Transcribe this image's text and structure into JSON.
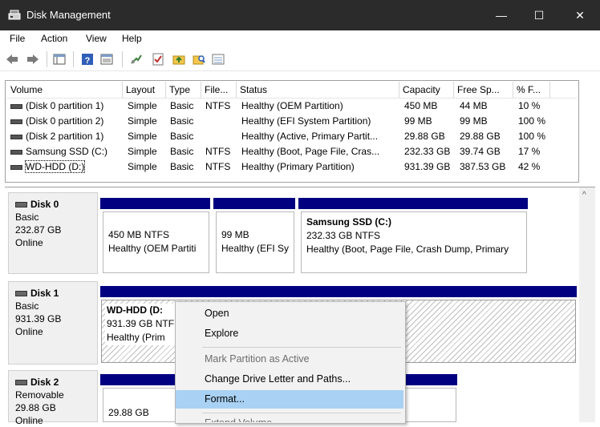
{
  "window": {
    "title": "Disk Management",
    "minimize": "—",
    "maximize": "☐",
    "close": "✕"
  },
  "menu": [
    "File",
    "Action",
    "View",
    "Help"
  ],
  "volume_list": {
    "columns": [
      "Volume",
      "Layout",
      "Type",
      "File...",
      "Status",
      "Capacity",
      "Free Sp...",
      "% F..."
    ],
    "rows": [
      [
        "(Disk 0 partition 1)",
        "Simple",
        "Basic",
        "NTFS",
        "Healthy (OEM Partition)",
        "450 MB",
        "44 MB",
        "10 %"
      ],
      [
        "(Disk 0 partition 2)",
        "Simple",
        "Basic",
        "",
        "Healthy (EFI System Partition)",
        "99 MB",
        "99 MB",
        "100 %"
      ],
      [
        "(Disk 2 partition 1)",
        "Simple",
        "Basic",
        "",
        "Healthy (Active, Primary Partit...",
        "29.88 GB",
        "29.88 GB",
        "100 %"
      ],
      [
        "Samsung SSD (C:)",
        "Simple",
        "Basic",
        "NTFS",
        "Healthy (Boot, Page File, Cras...",
        "232.33 GB",
        "39.74 GB",
        "17 %"
      ],
      [
        "WD-HDD (D:)",
        "Simple",
        "Basic",
        "NTFS",
        "Healthy (Primary Partition)",
        "931.39 GB",
        "387.53 GB",
        "42 %"
      ]
    ]
  },
  "disks": [
    {
      "name": "Disk 0",
      "type": "Basic",
      "size": "232.87 GB",
      "status": "Online",
      "partitions": [
        {
          "title": "",
          "line1": "450 MB NTFS",
          "line2": "Healthy (OEM Partiti"
        },
        {
          "title": "",
          "line1": "99 MB",
          "line2": "Healthy (EFI Sy"
        },
        {
          "title": "Samsung SSD  (C:)",
          "line1": "232.33 GB NTFS",
          "line2": "Healthy (Boot, Page File, Crash Dump, Primary"
        }
      ]
    },
    {
      "name": "Disk 1",
      "type": "Basic",
      "size": "931.39 GB",
      "status": "Online",
      "partitions": [
        {
          "title": "WD-HDD  (D:",
          "line1": "931.39 GB NTF",
          "line2": "Healthy (Prim"
        }
      ]
    },
    {
      "name": "Disk 2",
      "type": "Removable",
      "size": "29.88 GB",
      "status": "Online",
      "partitions": [
        {
          "title": "",
          "line1": "29.88 GB",
          "line2": ""
        }
      ]
    }
  ],
  "context_menu": {
    "items": [
      {
        "label": "Open",
        "enabled": true
      },
      {
        "label": "Explore",
        "enabled": true
      },
      {
        "label": "Mark Partition as Active",
        "enabled": false
      },
      {
        "label": "Change Drive Letter and Paths...",
        "enabled": true
      },
      {
        "label": "Format...",
        "enabled": true,
        "highlighted": true
      },
      {
        "label": "Extend Volume...",
        "enabled": false
      }
    ]
  },
  "colors": {
    "titlebar": "#2b2b2b",
    "partition_header": "#000080",
    "highlight": "#a9d1f3"
  }
}
